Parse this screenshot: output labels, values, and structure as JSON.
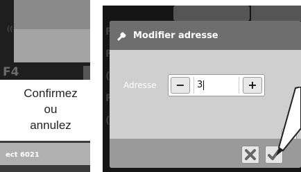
{
  "previous_screen": {
    "function_key": "F4",
    "bottom_bar_label": "ect 6021"
  },
  "caption": {
    "line1": "Confirmez",
    "line2": "ou",
    "line3": "annulez"
  },
  "dialog": {
    "title": "Modifier adresse",
    "address_label": "Adresse",
    "address_value": "3",
    "minus_label": "−",
    "plus_label": "+",
    "help_label": "?"
  },
  "colors": {
    "header": "#6e6e6e",
    "dialog_body": "#cfcfcf",
    "footer": "#9a9a9a"
  }
}
